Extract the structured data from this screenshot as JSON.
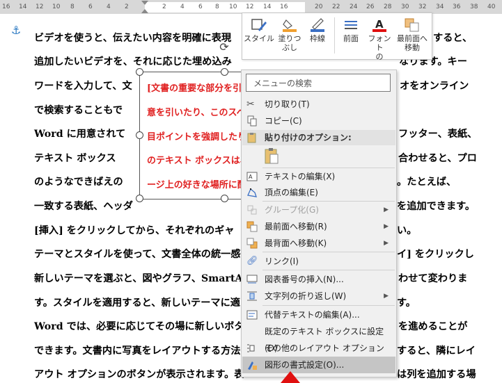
{
  "ruler": {
    "ticks": [
      "16",
      "14",
      "12",
      "10",
      "8",
      "6",
      "4",
      "2",
      "",
      "2",
      "4",
      "6",
      "8",
      "10",
      "12",
      "14",
      "16",
      "18",
      "20",
      "22",
      "24",
      "26",
      "28",
      "30",
      "32",
      "34",
      "36",
      "38",
      "40"
    ]
  },
  "document": {
    "lines": [
      "ビデオを使うと、伝えたい内容を明確に表現",
      "追加したいビデオを、それに応じた埋め込み",
      "ワードを入力して、文",
      "で検索することもで",
      "Word に用意されて",
      "テキスト ボックス",
      "のようなできばえの",
      "一致する表紙、ヘッダ",
      "[挿入] をクリックしてから、それぞれのギャ",
      "テーマとスタイルを使って、文書全体の統一感",
      "新しいテーマを選ぶと、図やグラフ、SmartAr",
      "す。スタイルを適用すると、新しいテーマに適",
      "Word では、必要に応じてその場に新しいボタ",
      "できます。文書内に写真をレイアウトする方法",
      "アウト オプションのボタンが表示されます。表"
    ],
    "right_lines": [
      "すると、",
      "なります。キー",
      "オをオンライン",
      "",
      "フッター、表紙、",
      "合わせると、プロ",
      "。たとえば、",
      "を追加できます。",
      "い。",
      "イ] をクリックし",
      "わせて変わりま",
      "す。",
      "を進めることが",
      "すると、隣にレイ",
      "は列を追加する場"
    ]
  },
  "textbox": {
    "lines": [
      "[文書の重要な部分を引",
      "意を引いたり、このスペ",
      "目ポイントを強調したり",
      "のテキスト ボックスは、",
      "ージ上の好きな場所に配"
    ]
  },
  "minitoolbar": {
    "style": "スタイル",
    "fill_line1": "塗りつ",
    "fill_line2": "ぶし",
    "outline": "枠線",
    "front": "前面",
    "font_line1": "フォント",
    "font_line2": "の",
    "bring_front_line1": "最前面へ",
    "bring_front_line2": "移動"
  },
  "menu": {
    "search_placeholder": "メニューの検索",
    "cut": "切り取り(T)",
    "copy": "コピー(C)",
    "paste_options": "貼り付けのオプション:",
    "edit_text": "テキストの編集(X)",
    "edit_points": "頂点の編集(E)",
    "group": "グループ化(G)",
    "bring_to_front": "最前面へ移動(R)",
    "send_to_back": "最背面へ移動(K)",
    "link": "リンク(I)",
    "insert_caption": "図表番号の挿入(N)...",
    "wrap_text": "文字列の折り返し(W)",
    "edit_alt_text": "代替テキストの編集(A)...",
    "set_default_textbox": "既定のテキスト ボックスに設定(D)",
    "more_layout_options": "その他のレイアウト オプション(L)...",
    "format_shape": "図形の書式設定(O)..."
  },
  "colors": {
    "accent_red": "#e01010",
    "textbox_text": "#e02020",
    "fill_orange": "#f0a030",
    "outline_blue": "#3a6fc4"
  }
}
